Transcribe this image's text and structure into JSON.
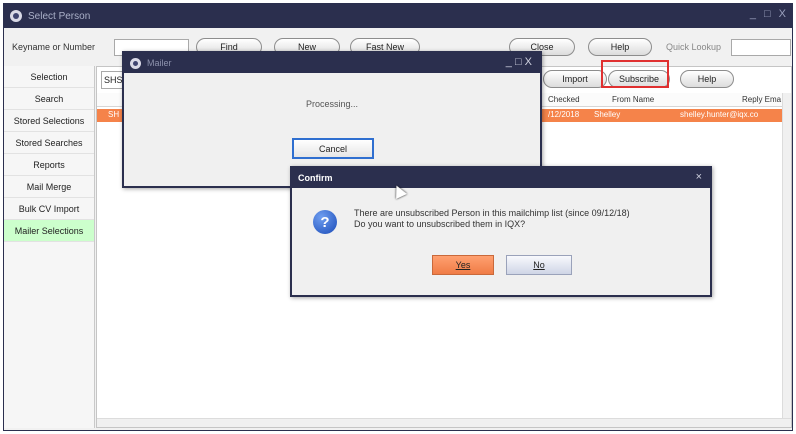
{
  "window": {
    "title": "Select Person",
    "controls": [
      "_",
      "□",
      "X"
    ]
  },
  "toolbar": {
    "keyname_label": "Keyname or Number",
    "keyname_value": "",
    "find": "Find",
    "new": "New",
    "fast_new": "Fast New",
    "close": "Close",
    "help": "Help",
    "quick_lookup_label": "Quick Lookup",
    "quick_lookup_value": ""
  },
  "content_toolbar": {
    "selection_value": "SHS",
    "import": "Import",
    "subscribe": "Subscribe",
    "help": "Help"
  },
  "sidebar": {
    "items": [
      "Selection",
      "Search",
      "Stored Selections",
      "Stored Searches",
      "Reports",
      "Mail Merge",
      "Bulk CV Import",
      "Mailer Selections"
    ],
    "active_index": 7
  },
  "table": {
    "headers": {
      "checked": "Checked",
      "from_name": "From Name",
      "reply_email": "Reply Ema"
    },
    "rows": [
      {
        "name": "SH",
        "checked": "/12/2018",
        "from_name": "Shelley",
        "reply_email": "shelley.hunter@iqx.co"
      }
    ]
  },
  "mailer_dialog": {
    "title": "Mailer",
    "message": "Processing...",
    "cancel": "Cancel"
  },
  "confirm_dialog": {
    "title": "Confirm",
    "line1": "There are unsubscribed Person in this mailchimp list (since 09/12/18)",
    "line2": "Do you want to unsubscribed them in IQX?",
    "yes": "Yes",
    "no": "No",
    "close": "×"
  },
  "colors": {
    "titlebar": "#2b2f4e",
    "selected_row": "#f5834a",
    "active_sidebar": "#ccffcc",
    "highlight": "#e03030"
  },
  "icons": {
    "question": "question-mark-icon",
    "app": "app-icon"
  }
}
